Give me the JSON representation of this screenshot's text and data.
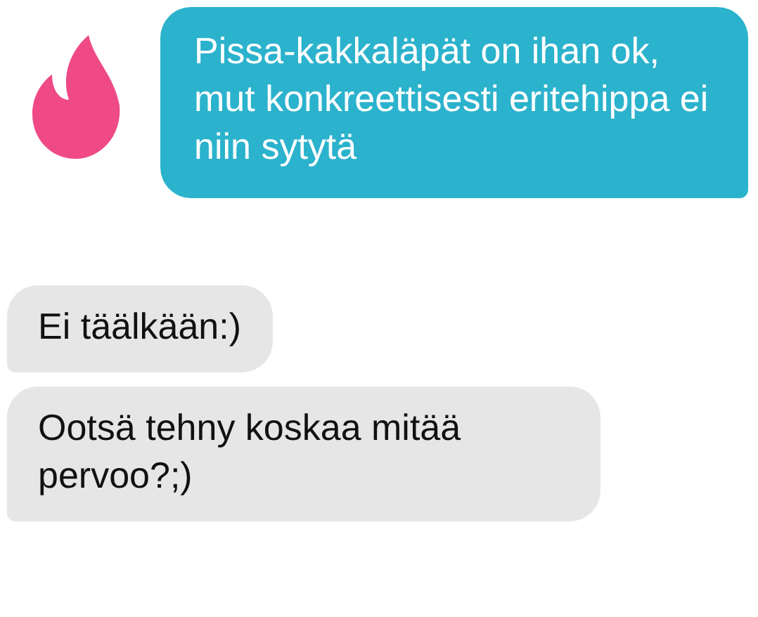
{
  "messages": [
    {
      "kind": "sent",
      "text": "Pissa-kakkaläpät on ihan ok, mut konkreettisesti eritehippa ei niin sytytä"
    },
    {
      "kind": "received",
      "text": "Ei täälkään:)"
    },
    {
      "kind": "received",
      "text": "Ootsä tehny koskaa mitää pervoo?;)"
    }
  ]
}
